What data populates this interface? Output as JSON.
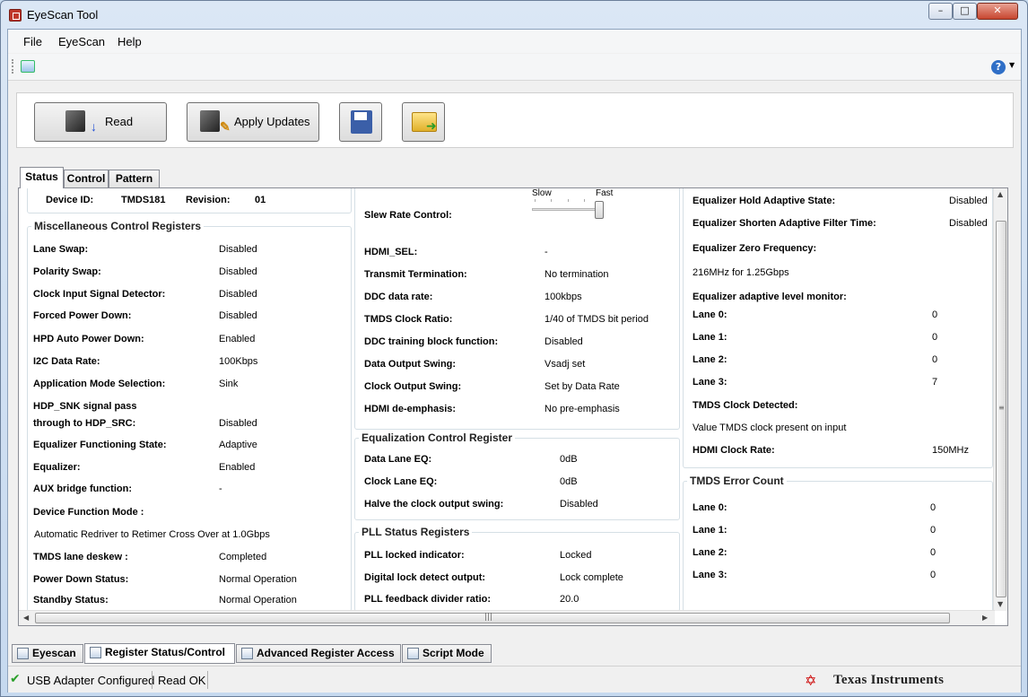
{
  "window": {
    "title": "EyeScan Tool"
  },
  "menu": [
    "File",
    "EyeScan",
    "Help"
  ],
  "actions": {
    "read_label": "Read",
    "apply_label": "Apply Updates"
  },
  "tabs": [
    "Status",
    "Control",
    "Pattern"
  ],
  "device": {
    "id_label": "Device ID:",
    "id_value": "TMDS181",
    "rev_label": "Revision:",
    "rev_value": "01"
  },
  "misc": {
    "title": "Miscellaneous Control Registers",
    "rows": [
      {
        "label": "Lane Swap:",
        "value": "Disabled"
      },
      {
        "label": "Polarity Swap:",
        "value": "Disabled"
      },
      {
        "label": "Clock Input Signal Detector:",
        "value": "Disabled"
      },
      {
        "label": "Forced Power Down:",
        "value": "Disabled"
      },
      {
        "label": "HPD Auto Power Down:",
        "value": "Enabled"
      },
      {
        "label": "I2C Data Rate:",
        "value": "100Kbps"
      },
      {
        "label": "Application Mode Selection:",
        "value": "Sink"
      },
      {
        "label": "HDP_SNK signal pass",
        "value": ""
      },
      {
        "label": "through to HDP_SRC:",
        "value": "Disabled"
      },
      {
        "label": "Equalizer Functioning State:",
        "value": "Adaptive"
      },
      {
        "label": "Equalizer:",
        "value": "Enabled"
      },
      {
        "label": "AUX bridge function:",
        "value": "-"
      },
      {
        "label": "Device Function Mode :",
        "value": ""
      }
    ],
    "function_mode_value": "Automatic Redriver to Retimer Cross Over at 1.0Gbps",
    "rows2": [
      {
        "label": "TMDS lane deskew :",
        "value": "Completed"
      },
      {
        "label": "Power Down Status:",
        "value": "Normal Operation"
      },
      {
        "label": "Standby Status:",
        "value": "Normal Operation"
      }
    ]
  },
  "slew": {
    "label": "Slew Rate Control:",
    "slow": "Slow",
    "fast": "Fast",
    "position": 1.0
  },
  "mid_rows": [
    {
      "label": "HDMI_SEL:",
      "value": "-"
    },
    {
      "label": "Transmit Termination:",
      "value": "No termination"
    },
    {
      "label": "DDC data rate:",
      "value": "100kbps"
    },
    {
      "label": "TMDS Clock Ratio:",
      "value": "1/40 of TMDS bit period"
    },
    {
      "label": "DDC training block function:",
      "value": "Disabled"
    },
    {
      "label": "Data Output Swing:",
      "value": "Vsadj set"
    },
    {
      "label": "Clock Output Swing:",
      "value": "Set by Data Rate"
    },
    {
      "label": "HDMI de-emphasis:",
      "value": "No pre-emphasis"
    }
  ],
  "eq_control": {
    "title": "Equalization Control Register",
    "rows": [
      {
        "label": "Data Lane EQ:",
        "value": "0dB"
      },
      {
        "label": "Clock Lane EQ:",
        "value": "0dB"
      },
      {
        "label": "Halve the clock output swing:",
        "value": "Disabled"
      }
    ]
  },
  "pll": {
    "title": "PLL Status Registers",
    "rows": [
      {
        "label": "PLL locked indicator:",
        "value": "Locked"
      },
      {
        "label": "Digital lock detect output:",
        "value": "Lock complete"
      },
      {
        "label": "PLL feedback divider ratio:",
        "value": "20.0"
      }
    ]
  },
  "right": {
    "hold_label": "Equalizer Hold Adaptive State:",
    "hold_value": "Disabled",
    "shorten_label": "Equalizer Shorten Adaptive Filter Time:",
    "shorten_value": "Disabled",
    "zero_label": "Equalizer Zero Frequency:",
    "zero_value": "216MHz for 1.25Gbps",
    "monitor_label": "Equalizer adaptive level monitor:",
    "lanes": [
      {
        "label": "Lane 0:",
        "value": "0"
      },
      {
        "label": "Lane 1:",
        "value": "0"
      },
      {
        "label": "Lane 2:",
        "value": "0"
      },
      {
        "label": "Lane 3:",
        "value": "7"
      }
    ],
    "clock_det_label": "TMDS Clock Detected:",
    "clock_det_value": "Value TMDS clock present on input",
    "rate_label": "HDMI Clock Rate:",
    "rate_value": "150MHz"
  },
  "error_count": {
    "title": "TMDS Error Count",
    "lanes": [
      {
        "label": "Lane 0:",
        "value": "0"
      },
      {
        "label": "Lane 1:",
        "value": "0"
      },
      {
        "label": "Lane 2:",
        "value": "0"
      },
      {
        "label": "Lane 3:",
        "value": "0"
      }
    ]
  },
  "bottom_tabs": [
    "Eyescan",
    "Register Status/Control",
    "Advanced Register Access",
    "Script Mode"
  ],
  "status": {
    "adapter": "USB Adapter Configured",
    "read": "Read OK",
    "brand": "Texas Instruments"
  }
}
